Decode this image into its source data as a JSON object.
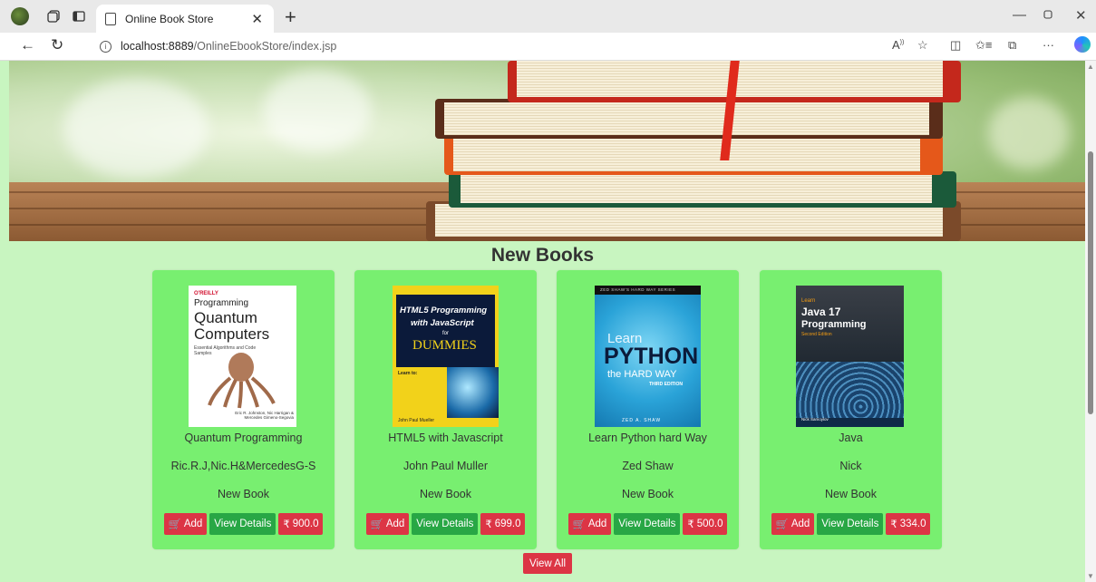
{
  "browser": {
    "tab_title": "Online Book Store",
    "new_tab_symbol": "+",
    "url_host": "localhost:8889",
    "url_path": "/OnlineEbookStore/index.jsp"
  },
  "page": {
    "section_title": "New Books",
    "view_all_label": "View All",
    "books": [
      {
        "title": "Quantum Programming",
        "author": "Ric.R.J,Nic.H&MercedesG-S",
        "category": "New Book",
        "add_label": "Add",
        "details_label": "View Details",
        "price": "900.0",
        "cover": {
          "publisher": "O'REILLY",
          "line1": "Programming",
          "line2": "Quantum",
          "line3": "Computers",
          "subtitle": "Essential Algorithms and Code Samples",
          "authors": "Eric R. Johnston, Nic Harrigan & Mercedes Gimeno-Segovia"
        }
      },
      {
        "title": "HTML5 with Javascript",
        "author": "John Paul Muller",
        "category": "New Book",
        "add_label": "Add",
        "details_label": "View Details",
        "price": "699.0",
        "cover": {
          "line1": "HTML5 Programming",
          "line2": "with JavaScript",
          "line3": "for",
          "line4": "DUMMIES",
          "learn": "Learn to:",
          "author": "John Paul Mueller"
        }
      },
      {
        "title": "Learn Python hard Way",
        "author": "Zed Shaw",
        "category": "New Book",
        "add_label": "Add",
        "details_label": "View Details",
        "price": "500.0",
        "cover": {
          "series": "ZED SHAW'S HARD WAY SERIES",
          "line1": "Learn",
          "line2": "PYTHON",
          "line3": "the HARD WAY",
          "edition": "THIRD EDITION",
          "author": "ZED A. SHAW"
        }
      },
      {
        "title": "Java",
        "author": "Nick",
        "category": "New Book",
        "add_label": "Add",
        "details_label": "View Details",
        "price": "334.0",
        "cover": {
          "line1": "Learn",
          "line2": "Java 17",
          "line3": "Programming",
          "edition": "Second Edition",
          "author": "Nick Samoylov"
        }
      }
    ]
  },
  "currency_symbol": "₹",
  "colors": {
    "page_bg": "#c8f5c0",
    "card_bg": "#78ef70",
    "danger": "#dc3545",
    "success": "#28a745"
  }
}
